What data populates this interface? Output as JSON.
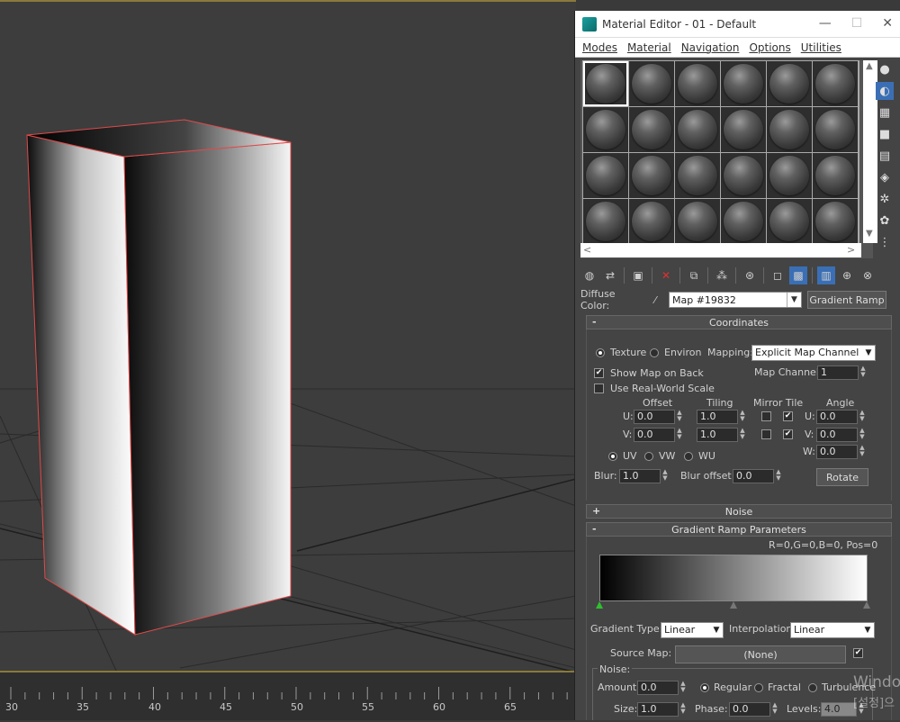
{
  "editor": {
    "title": "Material Editor - 01 - Default",
    "menu": [
      "Modes",
      "Material",
      "Navigation",
      "Options",
      "Utilities"
    ],
    "window_controls": [
      "minimize-icon",
      "maximize-icon",
      "close-icon"
    ],
    "slot_count": 24,
    "active_slot": 0
  },
  "diffuse": {
    "label": "Diffuse Color:",
    "map_name": "Map #19832",
    "map_type": "Gradient Ramp"
  },
  "coordinates": {
    "header": "Coordinates",
    "texture_label": "Texture",
    "environ_label": "Environ",
    "mapping_label": "Mapping:",
    "mapping_value": "Explicit Map Channel",
    "show_map_on_back": "Show Map on Back",
    "map_channel_label": "Map Channel:",
    "map_channel_value": "1",
    "real_world_scale": "Use Real-World Scale",
    "offset_label": "Offset",
    "tiling_label": "Tiling",
    "mirror_tile_label": "Mirror Tile",
    "angle_label": "Angle",
    "u_label": "U:",
    "v_label": "V:",
    "w_label": "W:",
    "offset_u": "0.0",
    "offset_v": "0.0",
    "tiling_u": "1.0",
    "tiling_v": "1.0",
    "angle_u": "0.0",
    "angle_v": "0.0",
    "angle_w": "0.0",
    "uv_label": "UV",
    "vw_label": "VW",
    "wu_label": "WU",
    "blur_label": "Blur:",
    "blur_value": "1.0",
    "blur_offset_label": "Blur offset:",
    "blur_offset_value": "0.0",
    "rotate_label": "Rotate"
  },
  "noise_rollout": {
    "header": "Noise"
  },
  "gradient_ramp": {
    "header": "Gradient Ramp Parameters",
    "readout": "R=0,G=0,B=0, Pos=0",
    "gradient_type_label": "Gradient Type:",
    "gradient_type_value": "Linear",
    "interpolation_label": "Interpolation:",
    "interpolation_value": "Linear",
    "source_map_label": "Source Map:",
    "source_map_value": "(None)",
    "noise_label": "Noise:",
    "amount_label": "Amount:",
    "amount_value": "0.0",
    "regular_label": "Regular",
    "fractal_label": "Fractal",
    "turbulence_label": "Turbulence",
    "size_label": "Size:",
    "size_value": "1.0",
    "phase_label": "Phase:",
    "phase_value": "0.0",
    "levels_label": "Levels:",
    "levels_value": "4.0"
  },
  "timeline": {
    "ticks": [
      "30",
      "35",
      "40",
      "45",
      "50",
      "55",
      "60",
      "65"
    ]
  },
  "watermark": {
    "line1": "Windo",
    "line2": "[설정]으"
  }
}
